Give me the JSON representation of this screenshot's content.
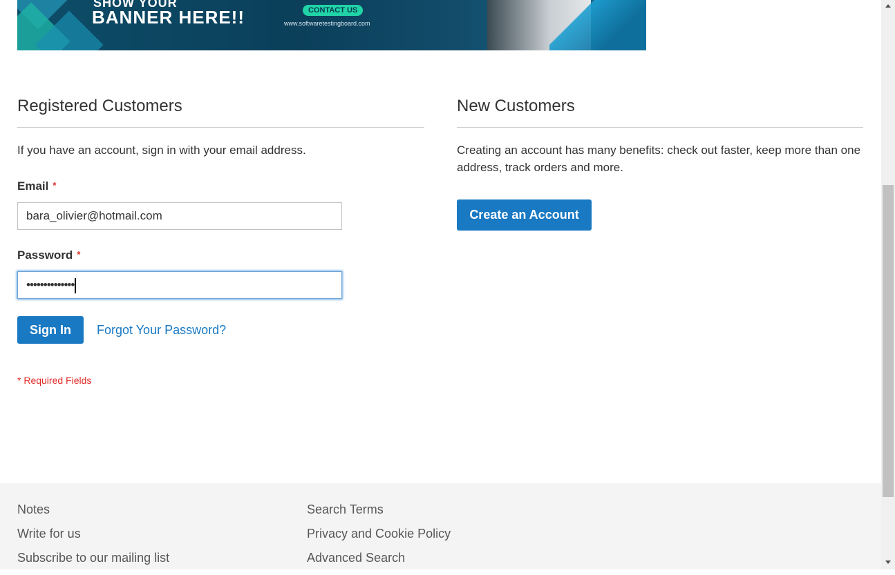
{
  "banner": {
    "headline_top": "SHOW YOUR",
    "headline_main": "BANNER HERE!!",
    "contact_label": "CONTACT US",
    "url": "www.softwaretestingboard.com"
  },
  "registered": {
    "title": "Registered Customers",
    "intro": "If you have an account, sign in with your email address.",
    "email_label": "Email",
    "email_value": "bara_olivier@hotmail.com",
    "password_label": "Password",
    "password_value": "••••••••••••••",
    "required_marker": "*",
    "sign_in_label": "Sign In",
    "forgot_label": "Forgot Your Password?",
    "required_note": "* Required Fields"
  },
  "new_customers": {
    "title": "New Customers",
    "intro": "Creating an account has many benefits: check out faster, keep more than one address, track orders and more.",
    "create_label": "Create an Account"
  },
  "footer": {
    "col1": [
      "Notes",
      "Write for us",
      "Subscribe to our mailing list"
    ],
    "col2": [
      "Search Terms",
      "Privacy and Cookie Policy",
      "Advanced Search"
    ]
  },
  "colors": {
    "primary": "#1979c3",
    "required": "#e02b27",
    "footer_bg": "#f4f4f4"
  }
}
